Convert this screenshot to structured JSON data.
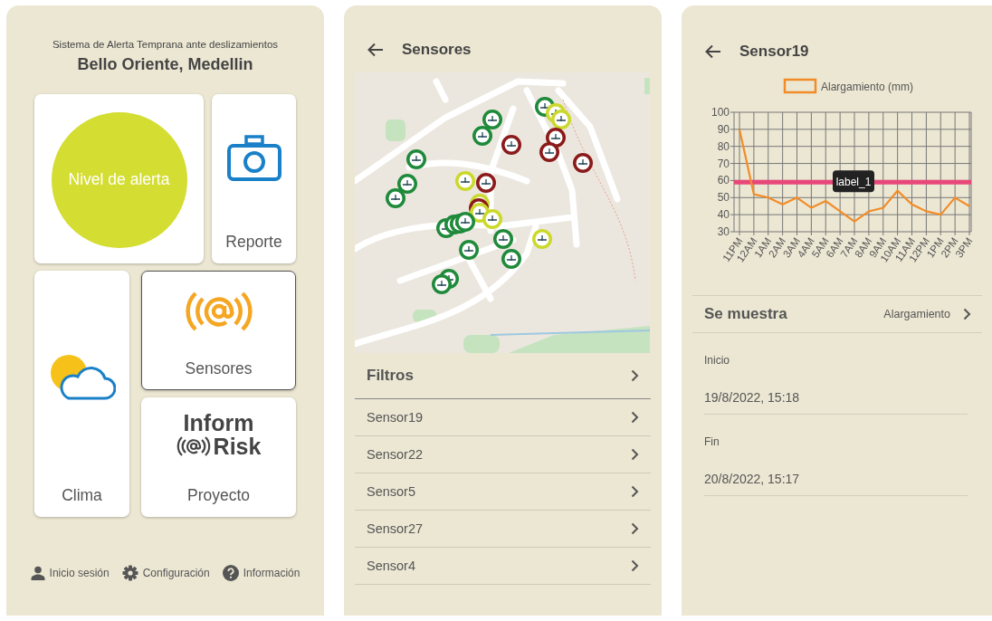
{
  "home": {
    "subtitle": "Sistema de Alerta Temprana ante deslizamientos",
    "title": "Bello Oriente, Medellin",
    "tiles": [
      {
        "kind": "alert",
        "label": "Nivel de alerta",
        "selected": false
      },
      {
        "kind": "report",
        "label": "Reporte",
        "selected": false
      },
      {
        "kind": "weather",
        "label": "Clima",
        "selected": false
      },
      {
        "kind": "sensors",
        "label": "Sensores",
        "selected": true
      },
      {
        "kind": "project",
        "label": "Proyecto",
        "logo_lines": [
          "Inform",
          "Risk"
        ],
        "selected": false
      }
    ],
    "footer_links": [
      {
        "kind": "user",
        "label": "Inicio sesión"
      },
      {
        "kind": "settings",
        "label": "Configuración"
      },
      {
        "kind": "help",
        "label": "Información"
      }
    ]
  },
  "sensors": {
    "title": "Sensores",
    "filters_label": "Filtros",
    "items": [
      "Sensor19",
      "Sensor22",
      "Sensor5",
      "Sensor27",
      "Sensor4"
    ]
  },
  "detail": {
    "title": "Sensor19",
    "chart_data": {
      "type": "line",
      "categories": [
        "11PM",
        "12AM",
        "1AM",
        "2AM",
        "3AM",
        "4AM",
        "5AM",
        "6AM",
        "7AM",
        "8AM",
        "9AM",
        "10AM",
        "11AM",
        "12PM",
        "1PM",
        "2PM",
        "3PM"
      ],
      "series": [
        {
          "name": "Alargamiento (mm)",
          "color": "#f28c28",
          "values": [
            90,
            52,
            50,
            46,
            50,
            44,
            48,
            42,
            36,
            42,
            44,
            54,
            46,
            42,
            40,
            50,
            45
          ]
        }
      ],
      "ylim": [
        30,
        100
      ],
      "yticks": [
        30,
        40,
        50,
        60,
        70,
        80,
        90,
        100
      ],
      "grid": true,
      "ref_lines": [
        {
          "axis": "y",
          "value": 59,
          "label": "label_1",
          "color": "#e8477a"
        }
      ]
    },
    "shown_label": "Se muestra",
    "shown_value": "Alargamiento",
    "fields": [
      {
        "label": "Inicio",
        "value": "19/8/2022, 15:18"
      },
      {
        "label": "Fin",
        "value": "20/8/2022, 15:17"
      }
    ]
  }
}
